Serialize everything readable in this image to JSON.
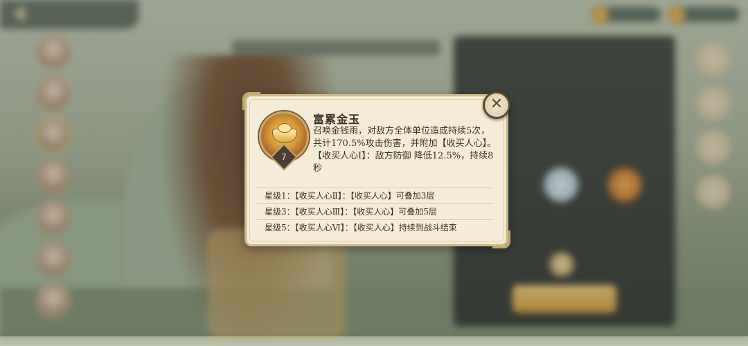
{
  "skill": {
    "name": "富累金玉",
    "level": "7",
    "description_lines": [
      "召唤金钱雨，对敌方全体单位造成持续5次，共计170.5%攻击伤害，并附加【收买人心】。",
      "【收买人心Ⅰ】：敌方防御 降低12.5%，持续8秒"
    ],
    "icon": "gold-ingot-icon"
  },
  "star_levels": [
    "星级1：【收买人心Ⅱ】：【收买人心】可叠加3层",
    "星级3：【收买人心Ⅲ】：【收买人心】可叠加5层",
    "星级5：【收买人心Ⅵ】：【收买人心】持续到战斗结束"
  ],
  "close_button": {
    "icon": "close-icon",
    "glyph": "✕"
  },
  "colors": {
    "card_bg": "#f4ecd6",
    "card_border": "#cdb98c",
    "text": "#3c3026",
    "close_border": "#5b4632"
  }
}
